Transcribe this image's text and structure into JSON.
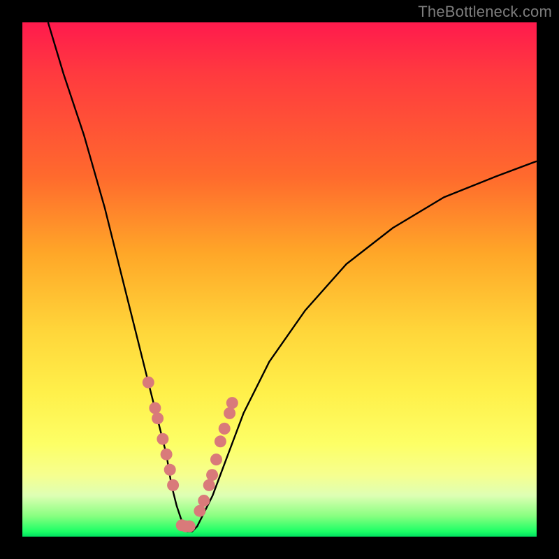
{
  "watermark": "TheBottleneck.com",
  "chart_data": {
    "type": "line",
    "title": "",
    "xlabel": "",
    "ylabel": "",
    "xlim": [
      0,
      100
    ],
    "ylim": [
      0,
      100
    ],
    "series": [
      {
        "name": "bottleneck-curve",
        "x": [
          5,
          8,
          12,
          16,
          19,
          22,
          24,
          26,
          28,
          29,
          30,
          31,
          32,
          33,
          34,
          35,
          37,
          40,
          43,
          48,
          55,
          63,
          72,
          82,
          92,
          100
        ],
        "y": [
          100,
          90,
          78,
          64,
          52,
          40,
          32,
          24,
          16,
          10,
          6,
          3,
          1,
          1,
          2,
          4,
          8,
          16,
          24,
          34,
          44,
          53,
          60,
          66,
          70,
          73
        ]
      }
    ],
    "markers": {
      "name": "highlighted-range",
      "color": "#d97a7a",
      "x": [
        24.5,
        25.8,
        26.3,
        27.3,
        28.0,
        28.7,
        29.3,
        31.0,
        31.8,
        32.5,
        34.5,
        35.3,
        36.3,
        36.9,
        37.7,
        38.5,
        39.3,
        40.3,
        40.8
      ],
      "y": [
        30,
        25,
        23,
        19,
        16,
        13,
        10,
        2.2,
        2.0,
        2.0,
        5,
        7,
        10,
        12,
        15,
        18.5,
        21,
        24,
        26
      ]
    },
    "gradient_stops": [
      {
        "pos": 0.0,
        "color": "#ff1a4d"
      },
      {
        "pos": 0.3,
        "color": "#ff6a2d"
      },
      {
        "pos": 0.6,
        "color": "#ffd63a"
      },
      {
        "pos": 0.85,
        "color": "#fdff66"
      },
      {
        "pos": 0.96,
        "color": "#88ff80"
      },
      {
        "pos": 1.0,
        "color": "#00e060"
      }
    ]
  }
}
